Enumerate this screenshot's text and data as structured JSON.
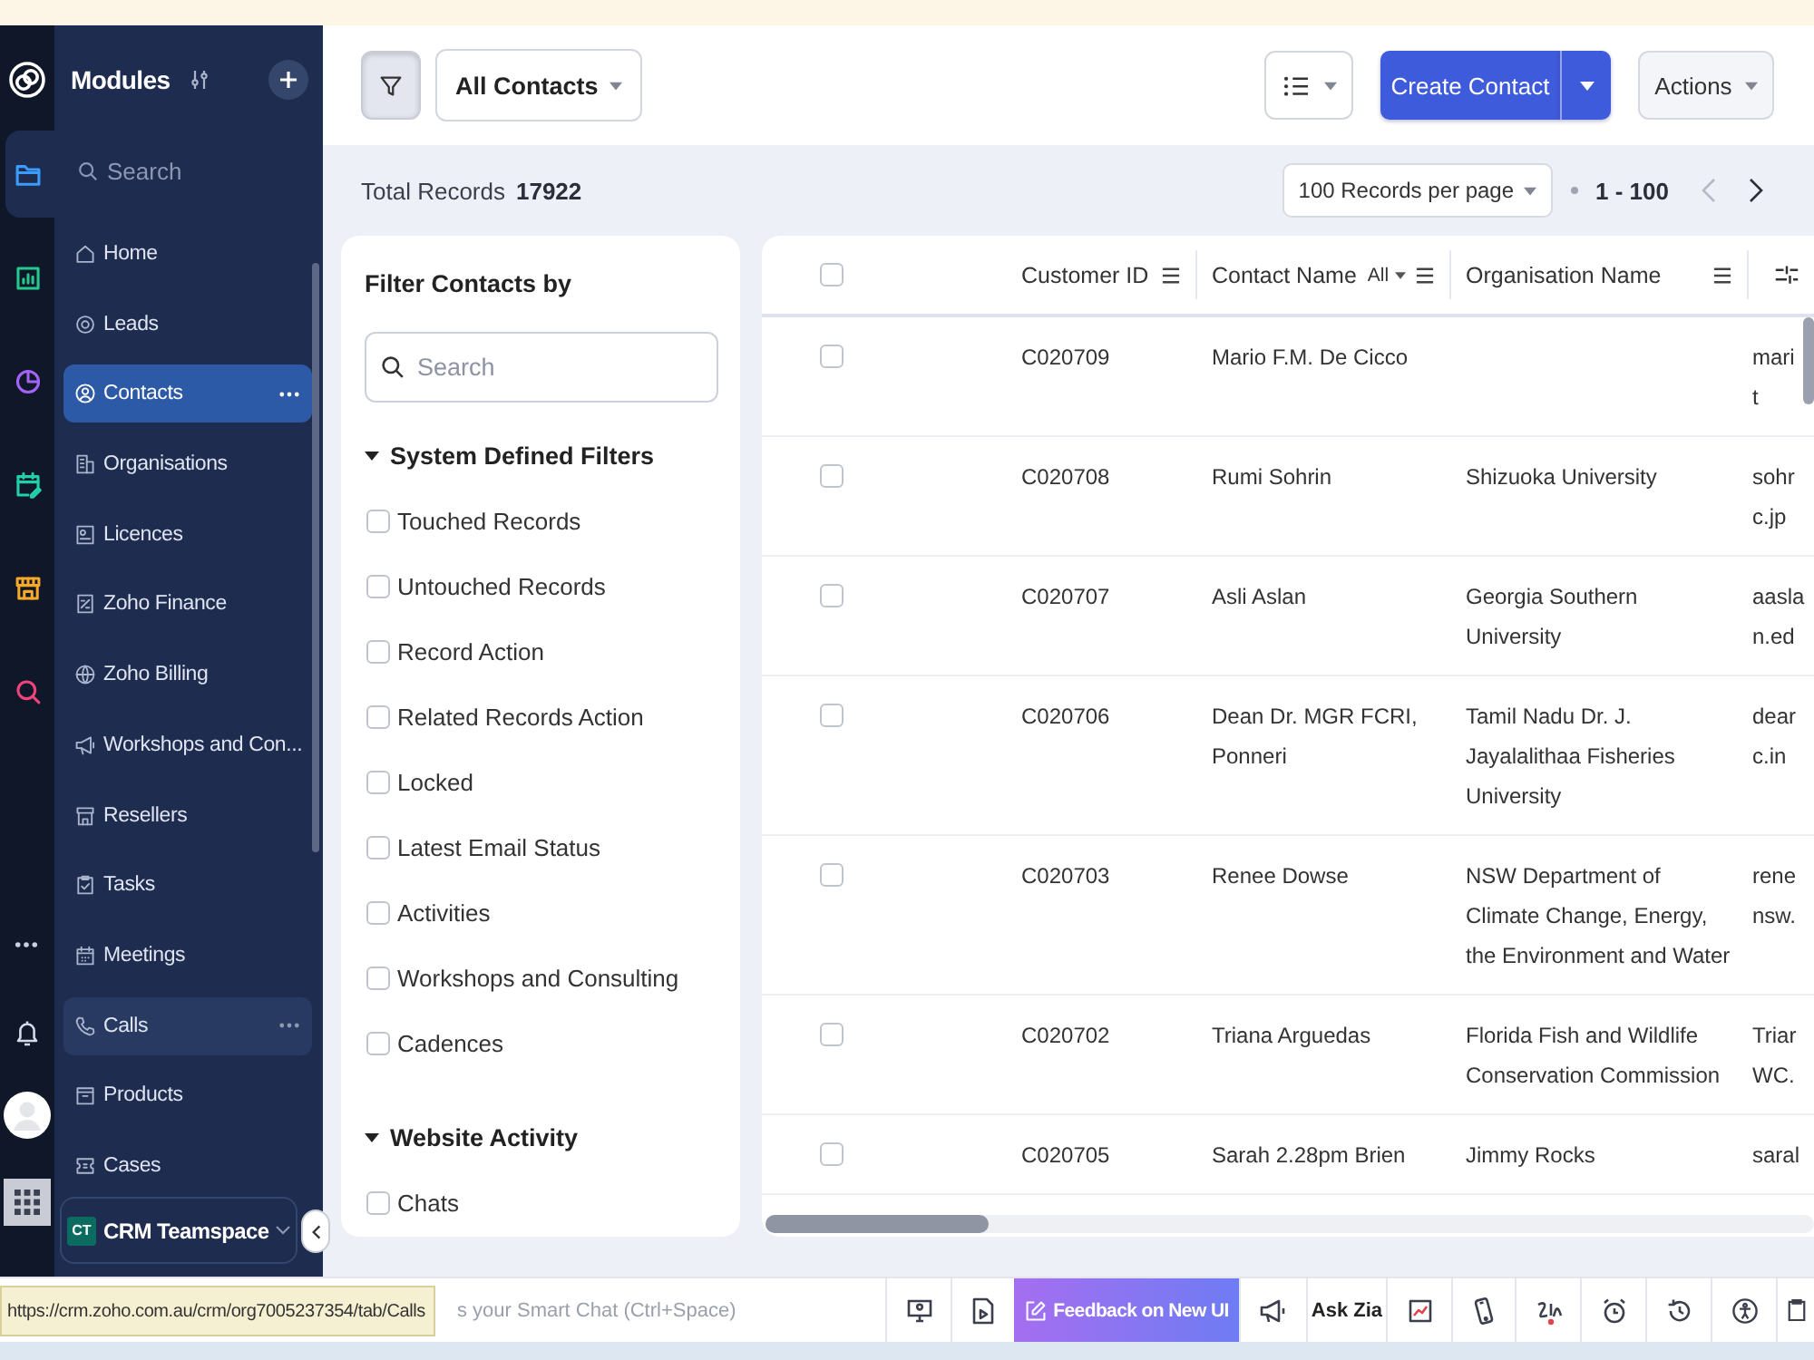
{
  "rail": [
    {
      "kind": "folder",
      "selected": true
    },
    {
      "kind": "bar-chart",
      "selected": false
    },
    {
      "kind": "pie-chart",
      "selected": false
    },
    {
      "kind": "calendar",
      "selected": false
    },
    {
      "kind": "store",
      "selected": false
    },
    {
      "kind": "search",
      "selected": false
    }
  ],
  "sidebar": {
    "title": "Modules",
    "search": {
      "placeholder": "Search"
    },
    "items": [
      {
        "label": "Home",
        "kind": "home",
        "selected": false,
        "hovered": false
      },
      {
        "label": "Leads",
        "kind": "leads",
        "selected": false,
        "hovered": false
      },
      {
        "label": "Contacts",
        "kind": "contacts",
        "selected": true,
        "hovered": false
      },
      {
        "label": "Organisations",
        "kind": "organisations",
        "selected": false,
        "hovered": false
      },
      {
        "label": "Licences",
        "kind": "licences",
        "selected": false,
        "hovered": false
      },
      {
        "label": "Zoho Finance",
        "kind": "finance",
        "selected": false,
        "hovered": false
      },
      {
        "label": "Zoho Billing",
        "kind": "billing",
        "selected": false,
        "hovered": false
      },
      {
        "label": "Workshops and Con...",
        "kind": "workshops",
        "selected": false,
        "hovered": false
      },
      {
        "label": "Resellers",
        "kind": "resellers",
        "selected": false,
        "hovered": false
      },
      {
        "label": "Tasks",
        "kind": "tasks",
        "selected": false,
        "hovered": false
      },
      {
        "label": "Meetings",
        "kind": "meetings",
        "selected": false,
        "hovered": false
      },
      {
        "label": "Calls",
        "kind": "calls",
        "selected": false,
        "hovered": true
      },
      {
        "label": "Products",
        "kind": "products",
        "selected": false,
        "hovered": false
      },
      {
        "label": "Cases",
        "kind": "cases",
        "selected": false,
        "hovered": false
      }
    ],
    "workspace": {
      "badge": "CT",
      "label": "CRM Teamspace"
    }
  },
  "toolbar": {
    "filter_toggle": {
      "on": true
    },
    "view_select": {
      "value": "All Contacts"
    },
    "create_button": {
      "label": "Create Contact"
    },
    "actions_button": {
      "label": "Actions"
    }
  },
  "records_bar": {
    "label": "Total Records",
    "count": "17922",
    "per_page": {
      "value": "100 Records per page"
    },
    "range": "1 - 100",
    "previous": {
      "disabled": true
    },
    "next": {
      "disabled": false
    }
  },
  "filter_panel": {
    "title": "Filter Contacts by",
    "search": {
      "placeholder": "Search"
    },
    "groups": [
      {
        "title": "System Defined Filters",
        "expanded": true,
        "items": [
          {
            "label": "Touched Records",
            "checked": false
          },
          {
            "label": "Untouched Records",
            "checked": false
          },
          {
            "label": "Record Action",
            "checked": false
          },
          {
            "label": "Related Records Action",
            "checked": false
          },
          {
            "label": "Locked",
            "checked": false
          },
          {
            "label": "Latest Email Status",
            "checked": false
          },
          {
            "label": "Activities",
            "checked": false
          },
          {
            "label": "Workshops and Consulting",
            "checked": false
          },
          {
            "label": "Cadences",
            "checked": false
          }
        ]
      },
      {
        "title": "Website Activity",
        "expanded": true,
        "items": [
          {
            "label": "Chats",
            "checked": false
          }
        ]
      }
    ]
  },
  "table": {
    "header_checked": false,
    "columns": [
      {
        "label": "Customer ID"
      },
      {
        "label": "Contact Name",
        "filter": "All"
      },
      {
        "label": "Organisation Name"
      }
    ],
    "rows": [
      {
        "checked": false,
        "customer_id": "C020709",
        "contact_name": "Mario F.M. De Cicco",
        "column_4": [
          "mari",
          "t"
        ]
      },
      {
        "checked": false,
        "customer_id": "C020708",
        "contact_name": "Rumi Sohrin",
        "organisation_name": "Shizuoka University",
        "column_4": [
          "sohr",
          "c.jp"
        ]
      },
      {
        "checked": false,
        "customer_id": "C020707",
        "contact_name": "Asli Aslan",
        "organisation_name": "Georgia Southern University",
        "column_4": [
          "aasla",
          "n.ed"
        ]
      },
      {
        "checked": false,
        "customer_id": "C020706",
        "contact_name": "Dean Dr. MGR FCRI, Ponneri",
        "organisation_name": "Tamil Nadu Dr. J. Jayalalithaa Fisheries University",
        "column_4": [
          "dear",
          "c.in"
        ]
      },
      {
        "checked": false,
        "customer_id": "C020703",
        "contact_name": "Renee Dowse",
        "organisation_name": "NSW Department of Climate Change, Energy, the Environment and Water",
        "column_4": [
          "rene",
          "nsw."
        ]
      },
      {
        "checked": false,
        "customer_id": "C020702",
        "contact_name": "Triana Arguedas",
        "organisation_name": "Florida Fish and Wildlife Conservation Commission",
        "column_4": [
          "Triar",
          "WC."
        ]
      },
      {
        "checked": false,
        "customer_id": "C020705",
        "contact_name": "Sarah 2.28pm Brien",
        "organisation_name": "Jimmy Rocks",
        "column_4": [
          "saral"
        ]
      }
    ]
  },
  "status_bar": {
    "url": "https://crm.zoho.com.au/crm/org7005237354/tab/Calls",
    "smart_chat": {
      "placeholder": "s your Smart Chat (Ctrl+Space)"
    },
    "feedback_button": {
      "label": "Feedback on New UI"
    },
    "ask_zia": {
      "label": "Ask Zia"
    }
  }
}
